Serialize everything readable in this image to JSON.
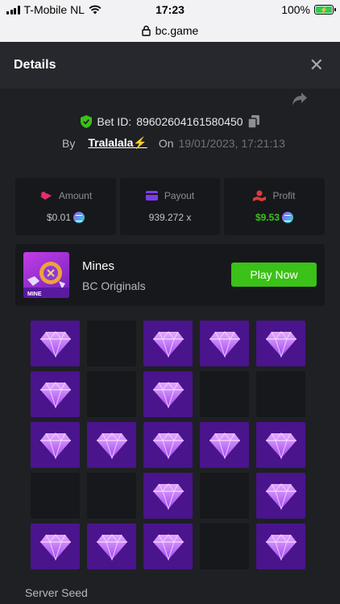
{
  "status_bar": {
    "carrier": "T-Mobile NL",
    "time": "17:23",
    "battery": "100%"
  },
  "url_bar": {
    "domain": "bc.game"
  },
  "header": {
    "title": "Details",
    "close_icon": "close-icon"
  },
  "bet": {
    "label": "Bet ID:",
    "id": "89602604161580450",
    "by_label": "By",
    "user": "Tralalala⚡",
    "on_label": "On",
    "date": "19/01/2023, 17:21:13"
  },
  "stats": [
    {
      "key": "amount",
      "label": "Amount",
      "value": "$0.01",
      "icon": "coins-icon"
    },
    {
      "key": "payout",
      "label": "Payout",
      "value": "939.272 x",
      "icon": "wallet-icon"
    },
    {
      "key": "profit",
      "label": "Profit",
      "value": "$9.53",
      "icon": "profit-icon"
    }
  ],
  "game": {
    "name": "Mines",
    "provider": "BC Originals",
    "thumb_text": "MINE",
    "play_label": "Play Now"
  },
  "grid": {
    "rows": [
      [
        "gem",
        "empty",
        "gem",
        "gem",
        "gem"
      ],
      [
        "gem",
        "empty",
        "gem",
        "empty",
        "empty"
      ],
      [
        "gem",
        "gem",
        "gem",
        "gem",
        "gem"
      ],
      [
        "empty",
        "empty",
        "gem",
        "empty",
        "gem"
      ],
      [
        "gem",
        "gem",
        "gem",
        "empty",
        "gem"
      ]
    ]
  },
  "seed": {
    "label": "Server Seed"
  },
  "colors": {
    "accent_green": "#3bc117",
    "gem_tile": "#4a148c",
    "background": "#1e2024"
  }
}
